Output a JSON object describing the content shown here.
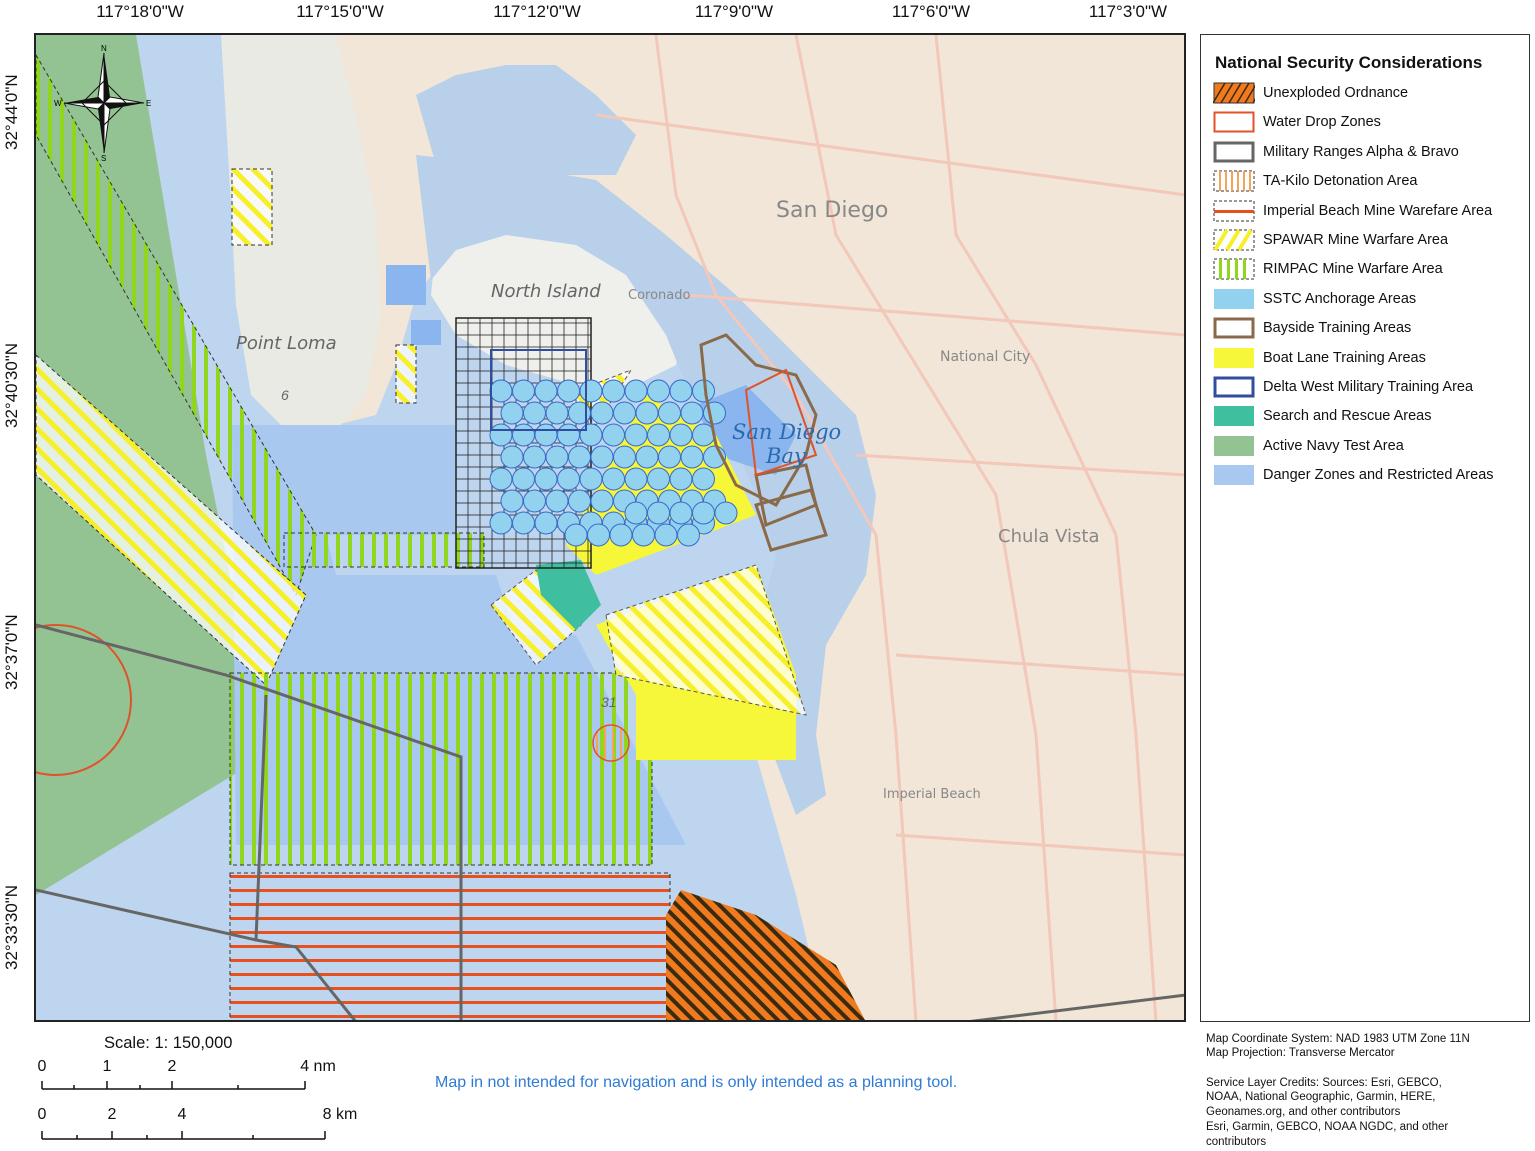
{
  "graticule": {
    "longitude_labels": [
      "117°18'0\"W",
      "117°15'0\"W",
      "117°12'0\"W",
      "117°9'0\"W",
      "117°6'0\"W",
      "117°3'0\"W"
    ],
    "latitude_labels": [
      "32°44'0\"N",
      "32°40'30\"N",
      "32°37'0\"N",
      "32°33'30\"N"
    ]
  },
  "map_labels": {
    "san_diego": "San Diego",
    "north_island": "North Island",
    "coronado": "Coronado",
    "point_loma": "Point Loma",
    "national_city": "National City",
    "san_diego_bay_line1": "San Diego",
    "san_diego_bay_line2": "Bay",
    "chula_vista": "Chula Vista",
    "imperial_beach": "Imperial Beach",
    "depth_6": "6",
    "depth_31": "31",
    "compass": {
      "n": "N",
      "s": "S",
      "e": "E",
      "w": "W"
    }
  },
  "legend": {
    "title": "National Security Considerations",
    "items": [
      {
        "label": "Unexploded Ordnance",
        "symbol": "hatch-orange",
        "color": "#f07a1e"
      },
      {
        "label": "Water Drop Zones",
        "symbol": "outline",
        "color": "#e0522a"
      },
      {
        "label": "Military Ranges Alpha & Bravo",
        "symbol": "outline-thick",
        "color": "#666666"
      },
      {
        "label": "TA-Kilo Detonation Area",
        "symbol": "vstripe-orange",
        "color": "#f2a45a"
      },
      {
        "label": "Imperial Beach Mine Warefare Area",
        "symbol": "hline-red",
        "color": "#e8501e"
      },
      {
        "label": "SPAWAR Mine Warfare Area",
        "symbol": "hatch-yellow",
        "color": "#f6ef2a"
      },
      {
        "label": "RIMPAC Mine Warfare Area",
        "symbol": "vstripe-green",
        "color": "#8fd61c"
      },
      {
        "label": "SSTC Anchorage Areas",
        "symbol": "fill",
        "color": "#92d2ef"
      },
      {
        "label": "Bayside Training Areas",
        "symbol": "outline-thick",
        "color": "#8a6a4a"
      },
      {
        "label": "Boat Lane Training Areas",
        "symbol": "fill",
        "color": "#f7f73a"
      },
      {
        "label": "Delta West Military Training Area",
        "symbol": "outline-thick",
        "color": "#2f4ea0"
      },
      {
        "label": "Search and Rescue Areas",
        "symbol": "fill",
        "color": "#3fbf9f"
      },
      {
        "label": "Active Navy Test Area",
        "symbol": "fill",
        "color": "#93c393"
      },
      {
        "label": "Danger Zones and Restricted Areas",
        "symbol": "fill",
        "color": "#a9c8f0"
      }
    ]
  },
  "metadata": {
    "coord_system": "Map Coordinate System: NAD 1983 UTM Zone 11N",
    "projection": "Map Projection: Transverse Mercator",
    "credits_1": "Service Layer Credits: Sources: Esri, GEBCO,",
    "credits_2": "NOAA, National Geographic, Garmin, HERE,",
    "credits_3": "Geonames.org, and other contributors",
    "credits_4": "Esri, Garmin, GEBCO, NOAA NGDC, and other",
    "credits_5": "contributors"
  },
  "scale": {
    "title": "Scale: 1: 150,000",
    "nm_labels": [
      "0",
      "1",
      "2",
      "4 nm"
    ],
    "km_labels": [
      "0",
      "2",
      "4",
      "8 km"
    ]
  },
  "disclaimer": "Map in not intended for navigation and is only intended as a planning tool."
}
